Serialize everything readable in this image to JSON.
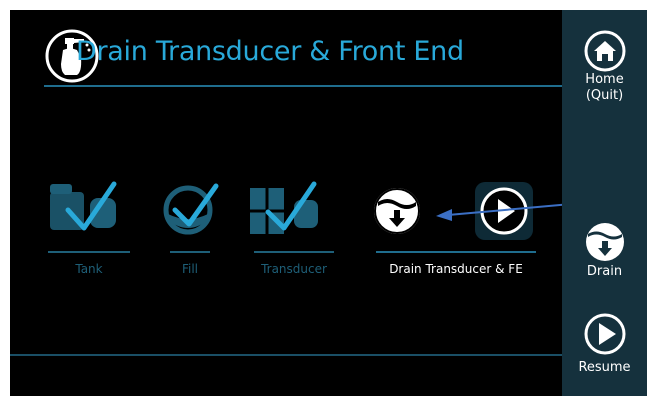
{
  "header": {
    "title": "Drain Transducer & Front End",
    "title_color": "#29a9d9",
    "icon": "spray-bottle-icon"
  },
  "steps": [
    {
      "label": "Tank",
      "state": "completed",
      "icon": "tank-check-icon"
    },
    {
      "label": "Fill",
      "state": "completed",
      "icon": "fill-check-icon"
    },
    {
      "label": "Transducer",
      "state": "completed",
      "icon": "transducer-check-icon"
    },
    {
      "label": "Drain Transducer & FE",
      "state": "current",
      "icon": "drain-icon"
    },
    {
      "label": "",
      "state": "pending",
      "icon": "resume-icon"
    }
  ],
  "sidebar": {
    "home_label_1": "Home",
    "home_label_2": "(Quit)",
    "drain_label": "Drain",
    "resume_label": "Resume",
    "background": "#15313d"
  },
  "annotation": {
    "arrow_color": "#3b6fc4",
    "points_to": "current-step-icon"
  },
  "colors": {
    "completed": "#1e5f78",
    "accent": "#29a9d9",
    "active": "#ffffff"
  }
}
